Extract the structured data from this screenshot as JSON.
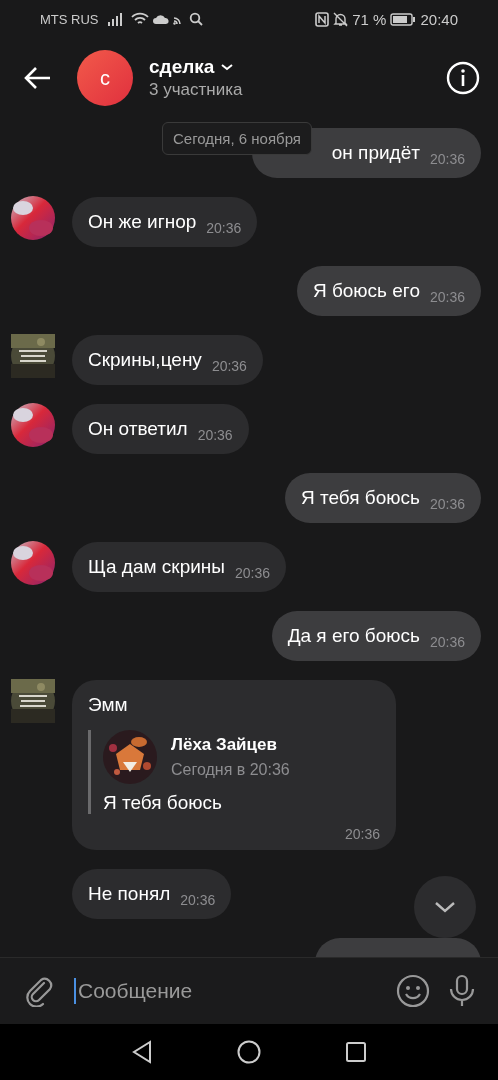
{
  "status_bar": {
    "carrier": "MTS RUS",
    "battery": "71 %",
    "time": "20:40"
  },
  "header": {
    "avatar_letter": "с",
    "title": "сделка",
    "subtitle": "3 участника"
  },
  "date_pill": "Сегодня, 6 ноября",
  "messages": [
    {
      "kind": "outgoing",
      "covered": true,
      "text": "он придёт",
      "time": "20:36"
    },
    {
      "kind": "incoming",
      "avatar": {
        "kind": "gradient"
      },
      "text": "Он же игнор",
      "time": "20:36"
    },
    {
      "kind": "outgoing",
      "text": "Я боюсь его",
      "time": "20:36"
    },
    {
      "kind": "incoming",
      "text": "Скрины,цену",
      "time": "20:36"
    },
    {
      "kind": "incoming",
      "avatar": {
        "kind": "gradient"
      },
      "text": "Он ответил",
      "time": "20:36"
    },
    {
      "kind": "outgoing",
      "text": "Я тебя боюсь",
      "time": "20:36"
    },
    {
      "kind": "incoming",
      "avatar": {
        "kind": "gradient"
      },
      "text": "Ща дам скрины",
      "time": "20:36"
    },
    {
      "kind": "outgoing",
      "text": "Да я его боюсь",
      "time": "20:36"
    },
    {
      "kind": "incoming",
      "text": "Эмм",
      "time": "20:36",
      "reply": {
        "author": "Лёха Зайцев",
        "time": "Сегодня в 20:36",
        "text": "Я тебя боюсь"
      }
    },
    {
      "kind": "incoming",
      "text": "Не понял",
      "time": "20:36"
    },
    {
      "kind": "outgoing"
    }
  ],
  "composer": {
    "placeholder": "Сообщение"
  }
}
